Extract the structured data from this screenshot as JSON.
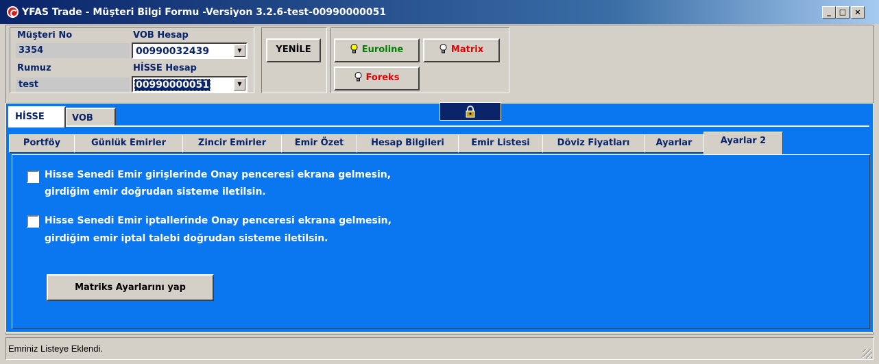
{
  "window": {
    "title": "YFAS Trade - Müşteri Bilgi Formu -Versiyon 3.2.6-test-00990000051",
    "minimize_symbol": "_",
    "maximize_symbol": "□",
    "close_symbol": "×"
  },
  "customer": {
    "musteri_no_label": "Müşteri No",
    "musteri_no": "3354",
    "rumuz_label": "Rumuz",
    "rumuz": "test",
    "vob_hesap_label": "VOB Hesap",
    "vob_hesap": "00990032439",
    "hisse_hesap_label": "HİSSE Hesap",
    "hisse_hesap": "00990000051"
  },
  "toolbar": {
    "yenile": "YENİLE",
    "euroline": "Euroline",
    "matrix": "Matrix",
    "foreks": "Foreks"
  },
  "outer_tabs": [
    "HİSSE",
    "VOB"
  ],
  "inner_tabs": [
    "Portföy",
    "Günlük Emirler",
    "Zincir Emirler",
    "Emir Özet",
    "Hesap Bilgileri",
    "Emir Listesi",
    "Döviz Fiyatları",
    "Ayarlar",
    "Ayarlar 2"
  ],
  "settings": {
    "option1_line1": "Hisse Senedi Emir girişlerinde Onay penceresi ekrana gelmesin,",
    "option1_line2": "girdiğim emir doğrudan sisteme iletilsin.",
    "option2_line1": "Hisse Senedi Emir iptallerinde Onay penceresi ekrana gelmesin,",
    "option2_line2": "girdiğim emir iptal talebi doğrudan sisteme iletilsin.",
    "option1_checked": false,
    "option2_checked": false,
    "matriks_button": "Matriks Ayarlarını yap"
  },
  "status": {
    "text": "Emriniz Listeye Eklendi."
  },
  "colors": {
    "panel_blue": "#0a77f0",
    "euroline": "#008000",
    "matrix": "#e00000",
    "foreks": "#e00000"
  }
}
